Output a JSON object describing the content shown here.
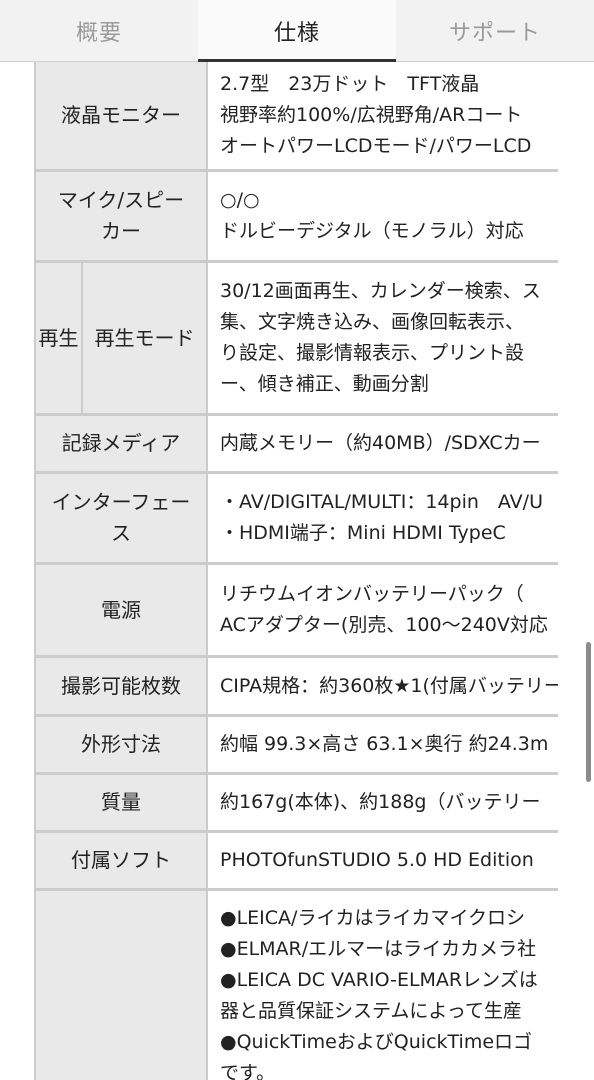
{
  "tabs": [
    {
      "label": "概要",
      "active": false
    },
    {
      "label": "仕様",
      "active": true
    },
    {
      "label": "サポート",
      "active": false
    }
  ],
  "rows": [
    {
      "label": "液晶モニター",
      "values": [
        "2.7型　23万ドット　TFT液晶",
        "視野率約100%/広視野角/ARコート",
        "オートパワーLCDモード/パワーLCD"
      ]
    },
    {
      "label": "マイク/スピーカー",
      "values": [
        "○/○",
        "ドルビーデジタル（モノラル）対応"
      ]
    },
    {
      "group": "再生",
      "label": "再生モード",
      "values": [
        "30/12画面再生、カレンダー検索、ス",
        "集、文字焼き込み、画像回転表示、",
        "り設定、撮影情報表示、プリント設",
        "ー、傾き補正、動画分割"
      ]
    },
    {
      "label": "記録メディア",
      "values": [
        "内蔵メモリー（約40MB）/SDXCカー"
      ]
    },
    {
      "label": "インターフェース",
      "values": [
        "・AV/DIGITAL/MULTI：14pin　AV/U",
        "・HDMI端子：Mini HDMI TypeC"
      ]
    },
    {
      "label": "電源",
      "values": [
        "リチウムイオンバッテリーパック（",
        "ACアダプター(別売、100〜240V対応"
      ]
    },
    {
      "label": "撮影可能枚数",
      "values": [
        "CIPA規格：約360枚★1(付属バッテリー"
      ]
    },
    {
      "label": "外形寸法",
      "values": [
        "約幅 99.3×高さ 63.1×奥行 約24.3m"
      ]
    },
    {
      "label": "質量",
      "values": [
        "約167g(本体)、約188g（バッテリー"
      ]
    },
    {
      "label": "付属ソフト",
      "values": [
        "PHOTOfunSTUDIO 5.0 HD Edition"
      ]
    },
    {
      "label": "",
      "values": [
        "●LEICA/ライカはライカマイクロシ",
        "●ELMAR/エルマーはライカカメラ社",
        "●LEICA DC VARIO-ELMARレンズは",
        "器と品質保証システムによって生産",
        "●QuickTimeおよびQuickTimeロゴ",
        "です。"
      ]
    }
  ]
}
